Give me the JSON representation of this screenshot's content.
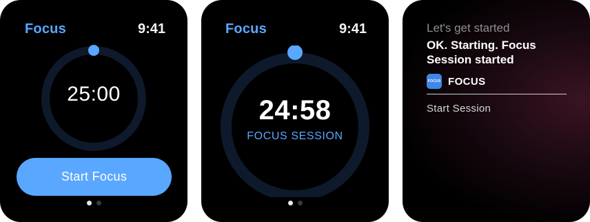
{
  "screens": {
    "start": {
      "app_title": "Focus",
      "time": "9:41",
      "timer": "25:00",
      "button_label": "Start Focus",
      "page_index": 1,
      "page_count": 2
    },
    "running": {
      "app_title": "Focus",
      "time": "9:41",
      "timer": "24:58",
      "session_label": "FOCUS SESSION",
      "page_index": 1,
      "page_count": 2
    },
    "siri": {
      "prompt": "Let's get started",
      "response": "OK. Starting. Focus Session started",
      "app_icon_text": "FOCUS",
      "app_name": "FOCUS",
      "shortcut": "Start Session"
    }
  },
  "colors": {
    "accent": "#5aa7ff",
    "ring_track": "#0e1a2b",
    "background": "#000000"
  }
}
